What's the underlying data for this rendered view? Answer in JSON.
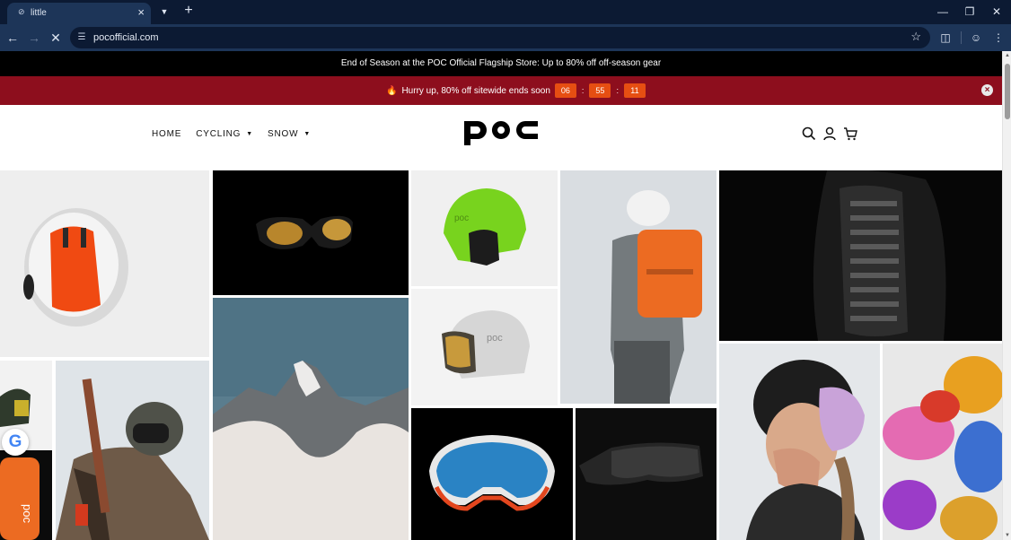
{
  "browser": {
    "tab": {
      "title": "little"
    },
    "address": {
      "url": "pocofficial.com"
    }
  },
  "announcement": {
    "text": "End of Season at the POC Official Flagship Store: Up to 80% off off-season gear"
  },
  "promo": {
    "text": "Hurry up, 80% off sitewide ends soon",
    "countdown": {
      "hours": "06",
      "minutes": "55",
      "seconds": "11"
    },
    "color": "#8d0e1d",
    "countdown_color": "#e64e12"
  },
  "header": {
    "nav": [
      {
        "label": "HOME"
      },
      {
        "label": "CYCLING"
      },
      {
        "label": "SNOW"
      }
    ],
    "logo": "POC"
  },
  "gallery": {
    "tiles": [
      {
        "subject": "white and orange helmet"
      },
      {
        "subject": "black sunglasses with gold lenses"
      },
      {
        "subject": "lime green ski helmet"
      },
      {
        "subject": "skier with orange backpack"
      },
      {
        "subject": "black spine protector"
      },
      {
        "subject": "white helmet with visor"
      },
      {
        "subject": "snowy mountain peak"
      },
      {
        "subject": "helmet on white background"
      },
      {
        "subject": "skier in camo jacket"
      },
      {
        "subject": "orange backpack"
      },
      {
        "subject": "goggles with blue lens"
      },
      {
        "subject": "black shield sunglasses"
      },
      {
        "subject": "woman with purple goggles"
      },
      {
        "subject": "colourful goggle lenses"
      }
    ]
  }
}
